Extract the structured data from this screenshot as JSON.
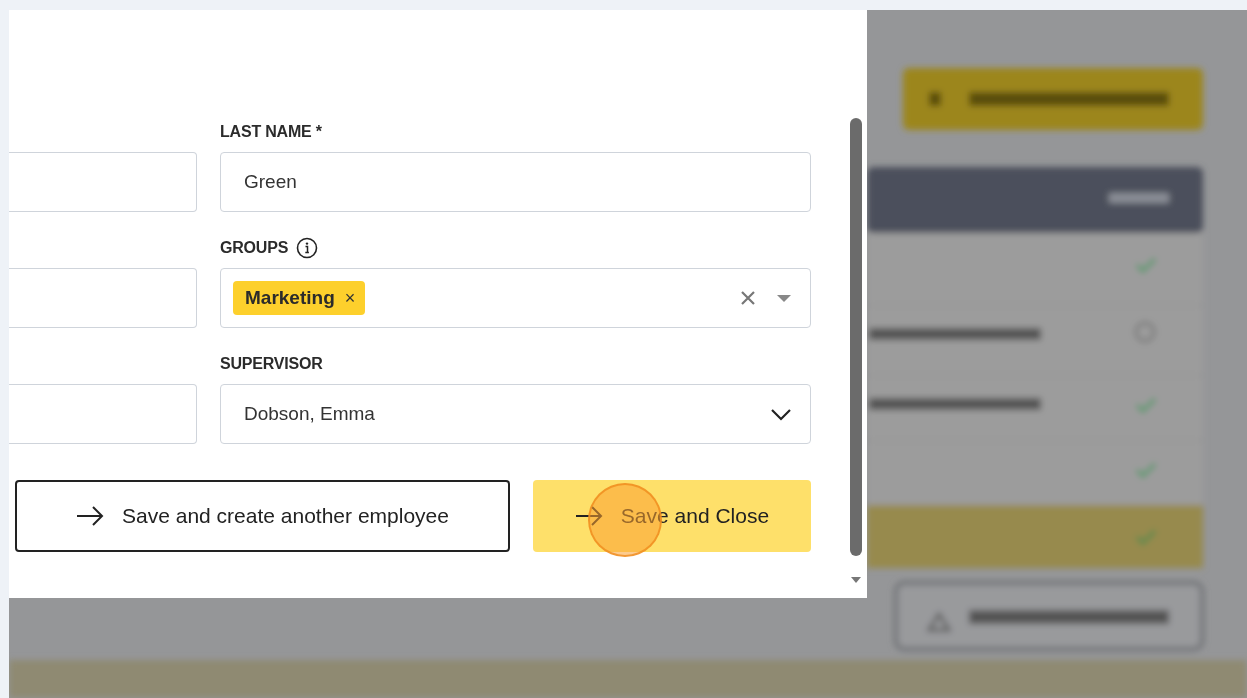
{
  "left_column_fields": [
    {
      "kind": "text"
    },
    {
      "kind": "text"
    },
    {
      "kind": "text"
    }
  ],
  "right_column_fields": [
    {
      "kind": "text",
      "label": "LAST NAME *",
      "value": "Green"
    },
    {
      "kind": "tags",
      "label": "GROUPS",
      "info": true,
      "tags": [
        {
          "label": "Marketing",
          "remove": "×"
        }
      ]
    },
    {
      "kind": "select",
      "label": "SUPERVISOR",
      "value": "Dobson, Emma"
    }
  ],
  "buttons": [
    {
      "label": "Save and create another employee",
      "primary": false
    },
    {
      "label": "Save and Close",
      "primary": true
    }
  ]
}
